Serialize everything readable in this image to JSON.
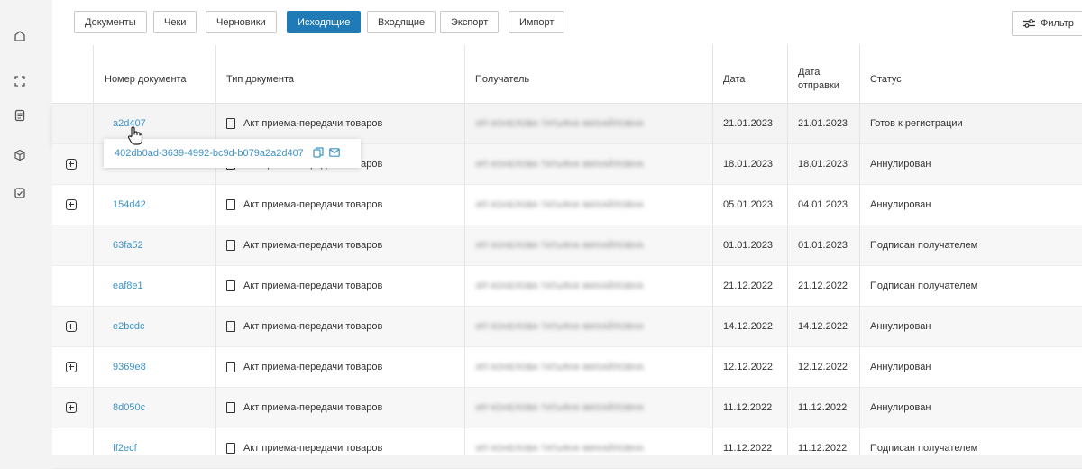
{
  "tabs": [
    {
      "label": "Документы",
      "active": false
    },
    {
      "label": "Чеки",
      "active": false
    },
    {
      "label": "Черновики",
      "active": false
    },
    {
      "label": "Исходящие",
      "active": true
    },
    {
      "label": "Входящие",
      "active": false
    },
    {
      "label": "Экспорт",
      "active": false
    },
    {
      "label": "Импорт",
      "active": false
    }
  ],
  "filter_label": "Фильтр",
  "columns": {
    "number": "Номер документа",
    "type": "Тип документа",
    "recipient": "Получатель",
    "date": "Дата",
    "sent_date": "Дата отправки",
    "status": "Статус"
  },
  "rows": [
    {
      "number": "a2d407",
      "type": "Акт приема-передачи товаров",
      "recipient": "ИП КОНЕЛОВА ТАТЬЯНА МИХАЙЛОВНА",
      "date": "21.01.2023",
      "sent": "21.01.2023",
      "status": "Готов к регистрации"
    },
    {
      "number": "",
      "type": "Акт приема-передачи товаров",
      "recipient": "ИП КОНЕЛОВА ТАТЬЯНА МИХАЙЛОВНА",
      "date": "18.01.2023",
      "sent": "18.01.2023",
      "status": "Аннулирован"
    },
    {
      "number": "154d42",
      "type": "Акт приема-передачи товаров",
      "recipient": "ИП КОНЕЛОВА ТАТЬЯНА МИХАЙЛОВНА",
      "date": "05.01.2023",
      "sent": "04.01.2023",
      "status": "Аннулирован"
    },
    {
      "number": "63fa52",
      "type": "Акт приема-передачи товаров",
      "recipient": "ИП КОНЕЛОВА ТАТЬЯНА МИХАЙЛОВНА",
      "date": "01.01.2023",
      "sent": "01.01.2023",
      "status": "Подписан получателем"
    },
    {
      "number": "eaf8e1",
      "type": "Акт приема-передачи товаров",
      "recipient": "ИП КОНЕЛОВА ТАТЬЯНА МИХАЙЛОВНА",
      "date": "21.12.2022",
      "sent": "21.12.2022",
      "status": "Подписан получателем"
    },
    {
      "number": "e2bcdc",
      "type": "Акт приема-передачи товаров",
      "recipient": "ИП КОНЕЛОВА ТАТЬЯНА МИХАЙЛОВНА",
      "date": "14.12.2022",
      "sent": "14.12.2022",
      "status": "Аннулирован"
    },
    {
      "number": "9369e8",
      "type": "Акт приема-передачи товаров",
      "recipient": "ИП КОНЕЛОВА ТАТЬЯНА МИХАЙЛОВНА",
      "date": "12.12.2022",
      "sent": "12.12.2022",
      "status": "Аннулирован"
    },
    {
      "number": "8d050c",
      "type": "Акт приема-передачи товаров",
      "recipient": "ИП КОНЕЛОВА ТАТЬЯНА МИХАЙЛОВНА",
      "date": "11.12.2022",
      "sent": "11.12.2022",
      "status": "Аннулирован"
    },
    {
      "number": "ff2ecf",
      "type": "Акт приема-передачи товаров",
      "recipient": "ИП КОНЕЛОВА ТАТЬЯНА МИХАЙЛОВНА",
      "date": "11.12.2022",
      "sent": "11.12.2022",
      "status": "Подписан получателем"
    }
  ],
  "tooltip": {
    "full_id": "402db0ad-3639-4992-bc9d-b079a2a2d407"
  },
  "colors": {
    "accent": "#1f7ab6",
    "link": "#3e92c6"
  }
}
